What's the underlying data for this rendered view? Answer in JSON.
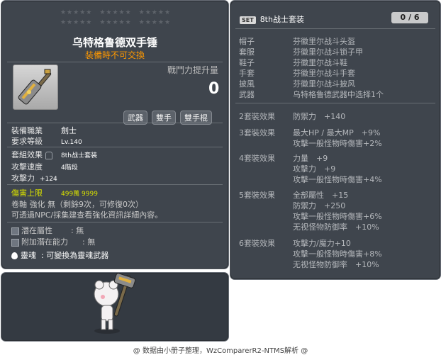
{
  "item_id": "01422171",
  "item": {
    "name": "乌特格鲁德双手锤",
    "trade_note": "装備時不可交換",
    "star_rows": [
      "★★★★★　★★★★★　★★★★★",
      "★★★★★　★★★★★　★★★★★"
    ],
    "power_label": "戰鬥力提升量",
    "power_value": "0",
    "tags": [
      "武器",
      "雙手",
      "雙手棍"
    ],
    "stats": {
      "job_label": "裝備職業",
      "job_value": "劍士",
      "level_label": "要求等級",
      "level_value": "Lv.140",
      "set_label": "套組效果",
      "set_value": "8th战士套装",
      "speed_label": "攻擊速度",
      "speed_value": "4階段",
      "attack_label": "攻擊力",
      "attack_value": "+124",
      "damage_cap_label": "傷害上限",
      "damage_cap_value": "499萬 9999",
      "scroll_line": "卷軸 強化 無（剩餘9次，可修復0次）",
      "npc_line": "可透過NPC/採集建查看強化資訊詳細內容。",
      "potential_label": "潛在屬性",
      "potential_value": ": 無",
      "bonus_potential_label": "附加潛在能力",
      "bonus_potential_value": ": 無",
      "soul_label": "靈魂",
      "soul_value": ": 可變換為靈魂武器"
    }
  },
  "set": {
    "badge": "SET",
    "name": "8th战士套装",
    "count": "0 / 6",
    "pieces": [
      {
        "slot": "帽子",
        "name": "芬徽里尔战斗头盔"
      },
      {
        "slot": "套服",
        "name": "芬徽里尔战斗锁子甲"
      },
      {
        "slot": "鞋子",
        "name": "芬徽里尔战斗鞋"
      },
      {
        "slot": "手套",
        "name": "芬徽里尔战斗手套"
      },
      {
        "slot": "披風",
        "name": "芬徽里尔战斗披风"
      },
      {
        "slot": "武器",
        "name": "乌特格鲁德武器中选择1个"
      }
    ],
    "bonuses": [
      {
        "label": "2套裝效果",
        "lines": [
          "防禦力　+140"
        ]
      },
      {
        "label": "3套裝效果",
        "lines": [
          "最大HP / 最大MP　+9%",
          "攻擊一般怪物時傷害+2%"
        ]
      },
      {
        "label": "4套裝效果",
        "lines": [
          "力量　+9",
          "攻擊力　+9",
          "攻擊一般怪物時傷害+4%"
        ]
      },
      {
        "label": "5套裝效果",
        "lines": [
          "全部屬性　+15",
          "防禦力　+250",
          "攻擊一般怪物時傷害+6%",
          "无视怪物防御率　+10%"
        ]
      },
      {
        "label": "6套裝效果",
        "lines": [
          "攻擊力/魔力+10",
          "攻擊一般怪物時傷害+8%",
          "无视怪物防御率　+10%"
        ]
      }
    ]
  },
  "footer": "@ 数据由小册子整理，WzComparerR2-NTMS解析 @"
}
